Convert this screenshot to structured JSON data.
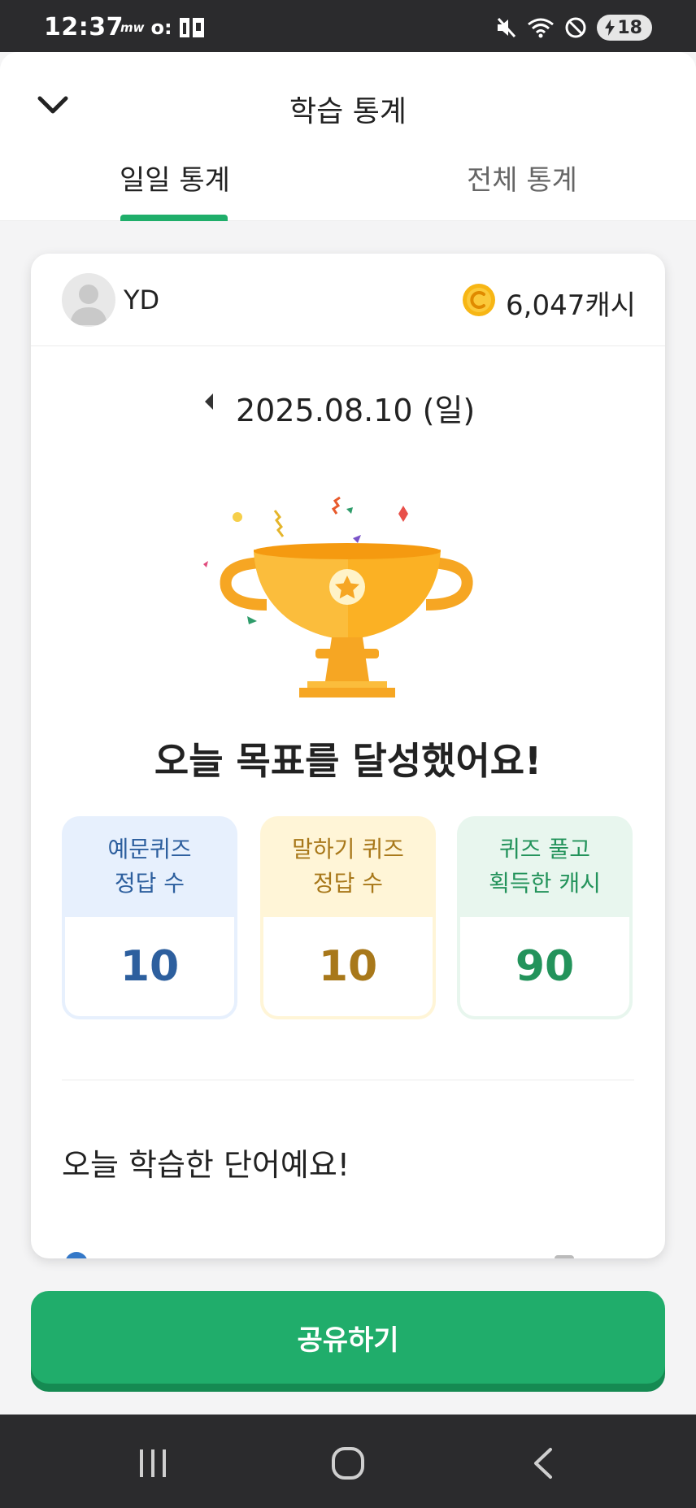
{
  "status_bar": {
    "time": "12:37",
    "left_icons": [
      "mw",
      "o:",
      "n"
    ],
    "battery_level": "18"
  },
  "header": {
    "title": "학습 통계",
    "tabs": [
      {
        "label": "일일 통계",
        "selected": true
      },
      {
        "label": "전체 통계",
        "selected": false
      }
    ]
  },
  "profile": {
    "username": "YD",
    "cash": "6,047캐시"
  },
  "date": "2025.08.10 (일)",
  "goal_message": "오늘 목표를 달성했어요!",
  "stats": [
    {
      "label_line1": "예문퀴즈",
      "label_line2": "정답 수",
      "value": "10",
      "color": "#2d5f9e"
    },
    {
      "label_line1": "말하기 퀴즈",
      "label_line2": "정답 수",
      "value": "10",
      "color": "#a8781a"
    },
    {
      "label_line1": "퀴즈 풀고",
      "label_line2": "획득한 캐시",
      "value": "90",
      "color": "#23935b"
    }
  ],
  "words_title": "오늘 학습한 단어예요!",
  "share_button": "공유하기",
  "colors": {
    "accent": "#20ad6b",
    "trophy": "#f9a826"
  },
  "icons": [
    "chevron-down-icon",
    "coin-icon",
    "trophy-icon",
    "prev-arrow-icon",
    "recents-icon",
    "home-icon",
    "back-icon"
  ]
}
